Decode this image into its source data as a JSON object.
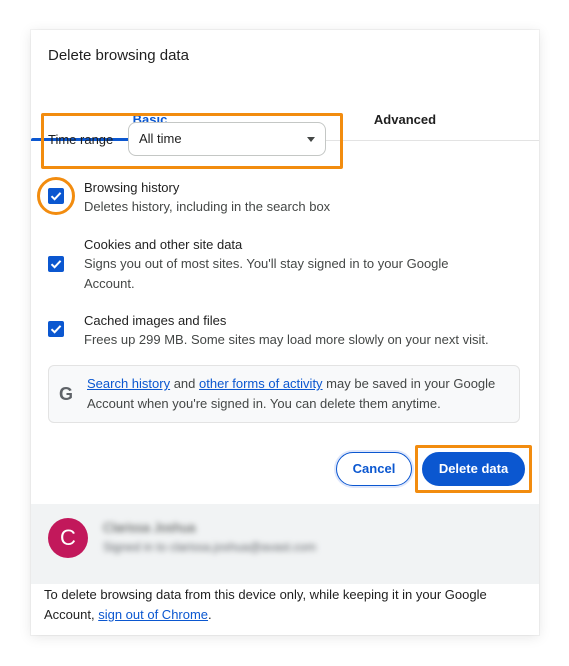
{
  "dialog": {
    "title": "Delete browsing data"
  },
  "tabs": [
    {
      "label": "Basic",
      "active": true
    },
    {
      "label": "Advanced",
      "active": false
    }
  ],
  "time_range": {
    "label": "Time range",
    "selected": "All time"
  },
  "options": [
    {
      "title": "Browsing history",
      "description": "Deletes history, including in the search box",
      "checked": true
    },
    {
      "title": "Cookies and other site data",
      "description": "Signs you out of most sites. You'll stay signed in to your Google Account.",
      "checked": true
    },
    {
      "title": "Cached images and files",
      "description": "Frees up 299 MB. Some sites may load more slowly on your next visit.",
      "checked": true
    }
  ],
  "info": {
    "icon": "google-g-icon",
    "link1": "Search history",
    "text1": " and ",
    "link2": "other forms of activity",
    "text2": " may be saved in your Google Account when you're signed in. You can delete them anytime."
  },
  "buttons": {
    "cancel": "Cancel",
    "delete": "Delete data"
  },
  "account": {
    "avatar_letter": "C",
    "name": "Clarissa Joshua",
    "subtitle": "Signed in to clarissa.joshua@avast.com"
  },
  "footer": {
    "text": "To delete browsing data from this device only, while keeping it in your Google Account, ",
    "link": "sign out of Chrome",
    "end": "."
  },
  "colors": {
    "accent": "#0b57d0",
    "highlight": "#f28c0f",
    "avatar": "#c2185b"
  }
}
